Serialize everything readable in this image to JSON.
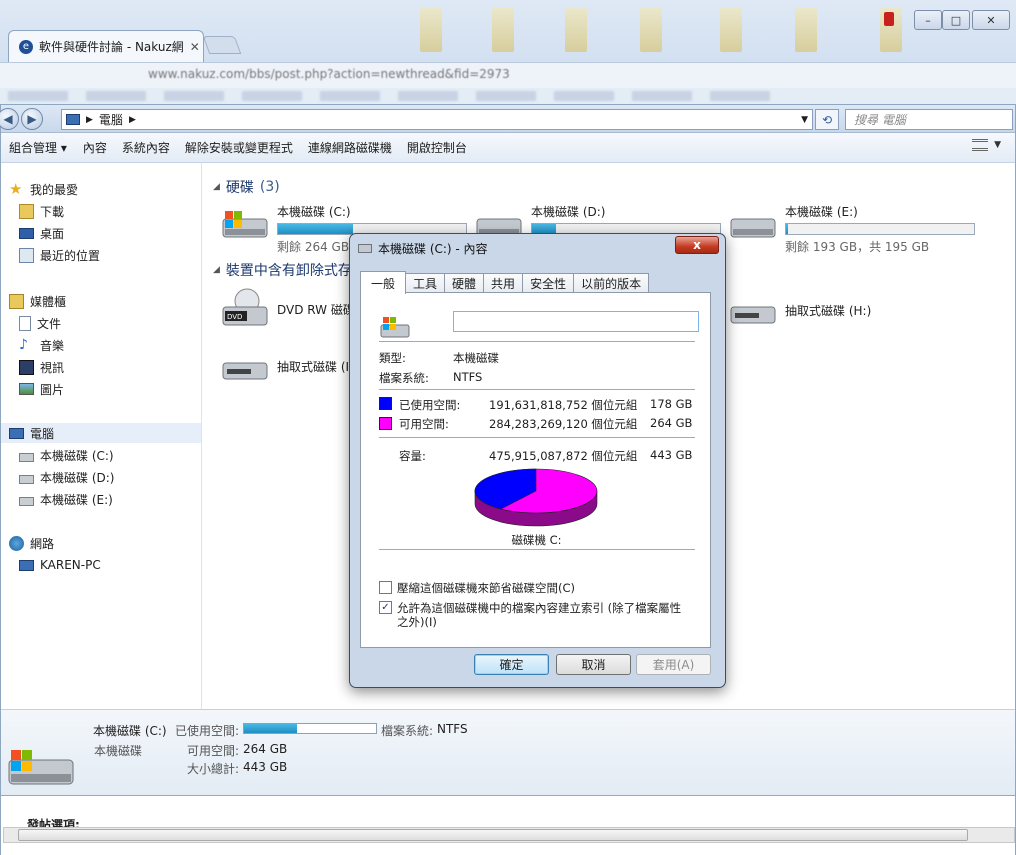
{
  "browser": {
    "tab_title": "軟件與硬件討論 - Nakuz網",
    "address_ghost": "www.nakuz.com/bbs/post.php?action=newthread&fid=2973",
    "controls": {
      "minimize": "–",
      "maximize": "□",
      "close": "✕"
    }
  },
  "explorer": {
    "breadcrumb": "電腦",
    "search_placeholder": "搜尋 電腦",
    "toolbar": [
      "組合管理",
      "內容",
      "系統內容",
      "解除安裝或變更程式",
      "連線網路磁碟機",
      "開啟控制台"
    ],
    "sidebar": {
      "favorites": {
        "label": "我的最愛",
        "items": [
          "下載",
          "桌面",
          "最近的位置"
        ]
      },
      "libraries": {
        "label": "媒體櫃",
        "items": [
          "文件",
          "音樂",
          "視訊",
          "圖片"
        ]
      },
      "computer": {
        "label": "電腦",
        "items": [
          "本機磁碟 (C:)",
          "本機磁碟 (D:)",
          "本機磁碟 (E:)"
        ]
      },
      "network": {
        "label": "網路",
        "items": [
          "KAREN-PC"
        ]
      }
    },
    "groups": {
      "hdd_title": "硬碟",
      "hdd_count": "(3)",
      "removable_title": "裝置中含有卸除式存放裝置"
    },
    "drives": {
      "c": {
        "name": "本機磁碟 (C:)",
        "free": "剩餘 264 GB",
        "used_fraction": 0.4
      },
      "d": {
        "name": "本機磁碟 (D:)",
        "used_fraction": 0.13
      },
      "e": {
        "name": "本機磁碟 (E:)",
        "free": "剩餘 193 GB，共 195 GB",
        "used_fraction": 0.01
      },
      "dvd": {
        "name": "DVD RW 磁碟"
      },
      "removable_i": {
        "name": "抽取式磁碟 (I:)"
      },
      "removable_h": {
        "name": "抽取式磁碟 (H:)"
      }
    },
    "details": {
      "name": "本機磁碟 (C:)",
      "type": "本機磁碟",
      "used_label": "已使用空間:",
      "free_label": "可用空間:",
      "free_value": "264 GB",
      "total_label": "大小總計:",
      "total_value": "443 GB",
      "fs_label": "檔案系統:",
      "fs_value": "NTFS",
      "used_fraction": 0.4
    },
    "bottom_text": "發帖選項:"
  },
  "dialog": {
    "title": "本機磁碟 (C:) - 內容",
    "close": "x",
    "tabs": [
      "一般",
      "工具",
      "硬體",
      "共用",
      "安全性",
      "以前的版本"
    ],
    "name_value": "",
    "type_label": "類型:",
    "type_value": "本機磁碟",
    "fs_label": "檔案系統:",
    "fs_value": "NTFS",
    "used": {
      "label": "已使用空間:",
      "bytes": "191,631,818,752 個位元組",
      "size": "178 GB",
      "color": "#0000ff"
    },
    "free": {
      "label": "可用空間:",
      "bytes": "284,283,269,120 個位元組",
      "size": "264 GB",
      "color": "#ff00ff"
    },
    "capacity": {
      "label": "容量:",
      "bytes": "475,915,087,872 個位元組",
      "size": "443 GB"
    },
    "pie": {
      "used_fraction": 0.4026,
      "caption": "磁碟機 C:"
    },
    "compress": {
      "label": "壓縮這個磁碟機來節省磁碟空間(C)",
      "checked": false
    },
    "index": {
      "label1": "允許為這個磁碟機中的檔案內容建立索引 (除了檔案屬性",
      "label2": "之外)(I)",
      "checked": true
    },
    "buttons": {
      "ok": "確定",
      "cancel": "取消",
      "apply": "套用(A)"
    }
  }
}
